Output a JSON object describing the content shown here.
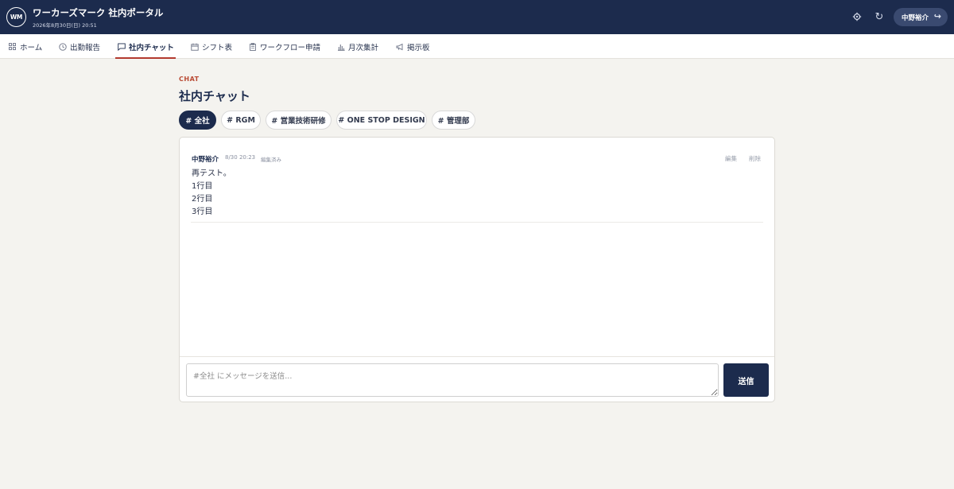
{
  "header": {
    "logo": "WM",
    "title": "ワーカーズマーク 社内ポータル",
    "datetime": "2026年8月30日(日) 20:51",
    "settings_icon": "gear-icon",
    "refresh_icon": "refresh-icon",
    "user_name": "中野裕介",
    "logout_icon": "logout-icon"
  },
  "nav": {
    "items": [
      {
        "label": "ホーム",
        "icon": "grid-icon"
      },
      {
        "label": "出勤報告",
        "icon": "clock-icon"
      },
      {
        "label": "社内チャット",
        "icon": "chat-icon",
        "active": true
      },
      {
        "label": "シフト表",
        "icon": "calendar-icon"
      },
      {
        "label": "ワークフロー申請",
        "icon": "clipboard-icon"
      },
      {
        "label": "月次集計",
        "icon": "bar-chart-icon"
      },
      {
        "label": "掲示板",
        "icon": "megaphone-icon"
      }
    ]
  },
  "main": {
    "eyebrow": "CHAT",
    "title": "社内チャット",
    "channels": [
      {
        "label": "# 全社",
        "active": true
      },
      {
        "label": "# RGM"
      },
      {
        "label": "# 営業技術研修"
      },
      {
        "label": "# ONE STOP DESIGN"
      },
      {
        "label": "# 管理部"
      }
    ]
  },
  "messages": [
    {
      "author": "中野裕介",
      "time": "8/30 20:23",
      "edited": "編集済み",
      "edit_label": "編集",
      "delete_label": "削除",
      "lines": [
        "再テスト。",
        "1行目",
        "2行目",
        "3行目"
      ]
    }
  ],
  "composer": {
    "placeholder": "#全社 にメッセージを送信...",
    "value": "",
    "send_label": "送信"
  }
}
